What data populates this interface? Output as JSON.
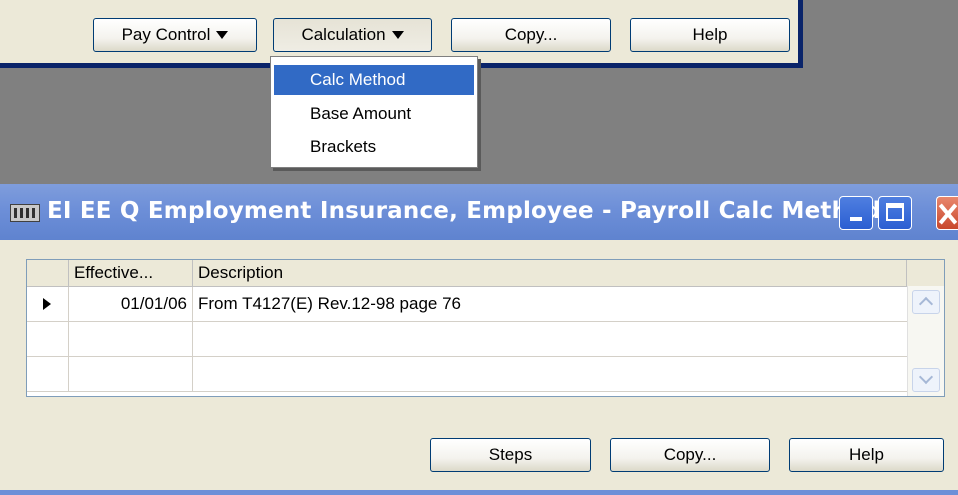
{
  "top_toolbar": {
    "pay_control_label": "Pay Control",
    "calculation_label": "Calculation",
    "copy_label": "Copy...",
    "help_label": "Help"
  },
  "calculation_menu": {
    "items": [
      "Calc Method",
      "Base Amount",
      "Brackets"
    ],
    "selected": "Calc Method"
  },
  "window": {
    "title": "EI EE Q Employment Insurance, Employee - Payroll Calc Method"
  },
  "grid": {
    "columns": [
      "Effective...",
      "Description"
    ],
    "rows": [
      {
        "effective": "01/01/06",
        "description": "From T4127(E) Rev.12-98 page 76",
        "current": true
      },
      {
        "effective": "",
        "description": "",
        "current": false
      },
      {
        "effective": "",
        "description": "",
        "current": false
      }
    ]
  },
  "bottom_buttons": {
    "steps_label": "Steps",
    "copy_label": "Copy...",
    "help_label": "Help"
  },
  "colors": {
    "titlebar": "#6d8fd8",
    "menu_highlight": "#316ac5",
    "window_face": "#ece9d8"
  }
}
